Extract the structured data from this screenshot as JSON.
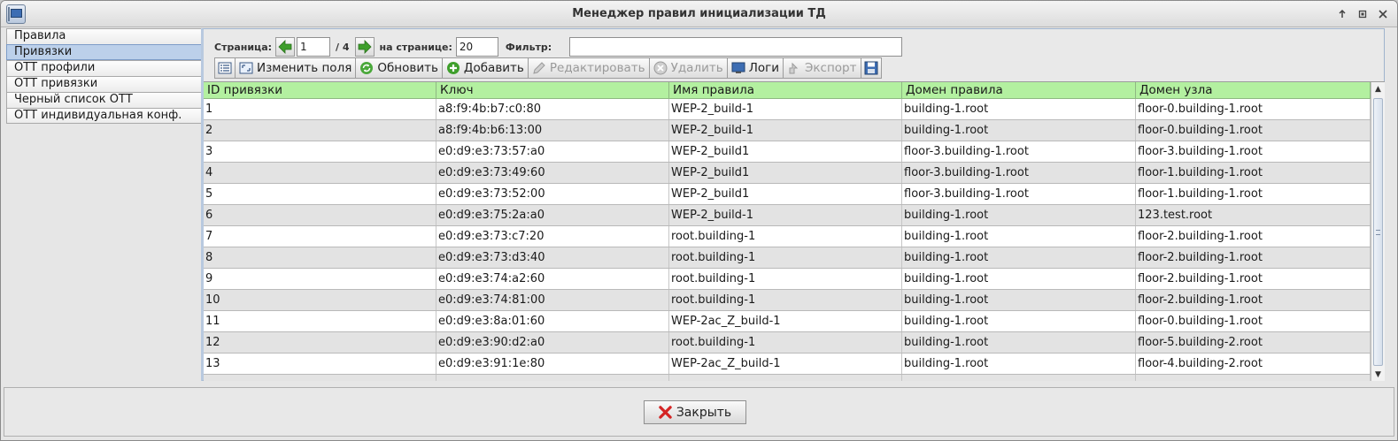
{
  "window": {
    "title": "Менеджер правил инициализации ТД"
  },
  "nav": {
    "items": [
      {
        "label": "Правила"
      },
      {
        "label": "Привязки"
      },
      {
        "label": "ОТТ профили"
      },
      {
        "label": "ОТТ привязки"
      },
      {
        "label": "Черный список ОТТ"
      },
      {
        "label": "ОТТ индивидуальная конф."
      }
    ],
    "selected": "Привязки"
  },
  "pager": {
    "page_label": "Страница:",
    "page_value": "1",
    "total_pages": "/ 4",
    "per_page_label": "на странице:",
    "per_page_value": "20",
    "filter_label": "Фильтр:",
    "filter_value": ""
  },
  "toolbar": {
    "edit_fields": "Изменить поля",
    "refresh": "Обновить",
    "add": "Добавить",
    "edit": "Редактировать",
    "delete": "Удалить",
    "logs": "Логи",
    "export": "Экспорт"
  },
  "table": {
    "columns": [
      "ID привязки",
      "Ключ",
      "Имя правила",
      "Домен правила",
      "Домен узла"
    ],
    "rows": [
      [
        "1",
        "a8:f9:4b:b7:c0:80",
        "WEP-2_build-1",
        "building-1.root",
        "floor-0.building-1.root"
      ],
      [
        "2",
        "a8:f9:4b:b6:13:00",
        "WEP-2_build-1",
        "building-1.root",
        "floor-0.building-1.root"
      ],
      [
        "3",
        "e0:d9:e3:73:57:a0",
        "WEP-2_build1",
        "floor-3.building-1.root",
        "floor-3.building-1.root"
      ],
      [
        "4",
        "e0:d9:e3:73:49:60",
        "WEP-2_build1",
        "floor-3.building-1.root",
        "floor-1.building-1.root"
      ],
      [
        "5",
        "e0:d9:e3:73:52:00",
        "WEP-2_build1",
        "floor-3.building-1.root",
        "floor-1.building-1.root"
      ],
      [
        "6",
        "e0:d9:e3:75:2a:a0",
        "WEP-2_build-1",
        "building-1.root",
        "123.test.root"
      ],
      [
        "7",
        "e0:d9:e3:73:c7:20",
        "root.building-1",
        "building-1.root",
        "floor-2.building-1.root"
      ],
      [
        "8",
        "e0:d9:e3:73:d3:40",
        "root.building-1",
        "building-1.root",
        "floor-2.building-1.root"
      ],
      [
        "9",
        "e0:d9:e3:74:a2:60",
        "root.building-1",
        "building-1.root",
        "floor-2.building-1.root"
      ],
      [
        "10",
        "e0:d9:e3:74:81:00",
        "root.building-1",
        "building-1.root",
        "floor-2.building-1.root"
      ],
      [
        "11",
        "e0:d9:e3:8a:01:60",
        "WEP-2ac_Z_build-1",
        "building-1.root",
        "floor-0.building-1.root"
      ],
      [
        "12",
        "e0:d9:e3:90:d2:a0",
        "root.building-1",
        "building-1.root",
        "floor-5.building-2.root"
      ],
      [
        "13",
        "e0:d9:e3:91:1e:80",
        "WEP-2ac_Z_build-1",
        "building-1.root",
        "floor-4.building-2.root"
      ]
    ]
  },
  "footer": {
    "close": "Закрыть"
  },
  "colors": {
    "header_bg": "#b3f0a0",
    "selected_nav": "#bcd0ea",
    "alt_row": "#e3e3e3"
  }
}
